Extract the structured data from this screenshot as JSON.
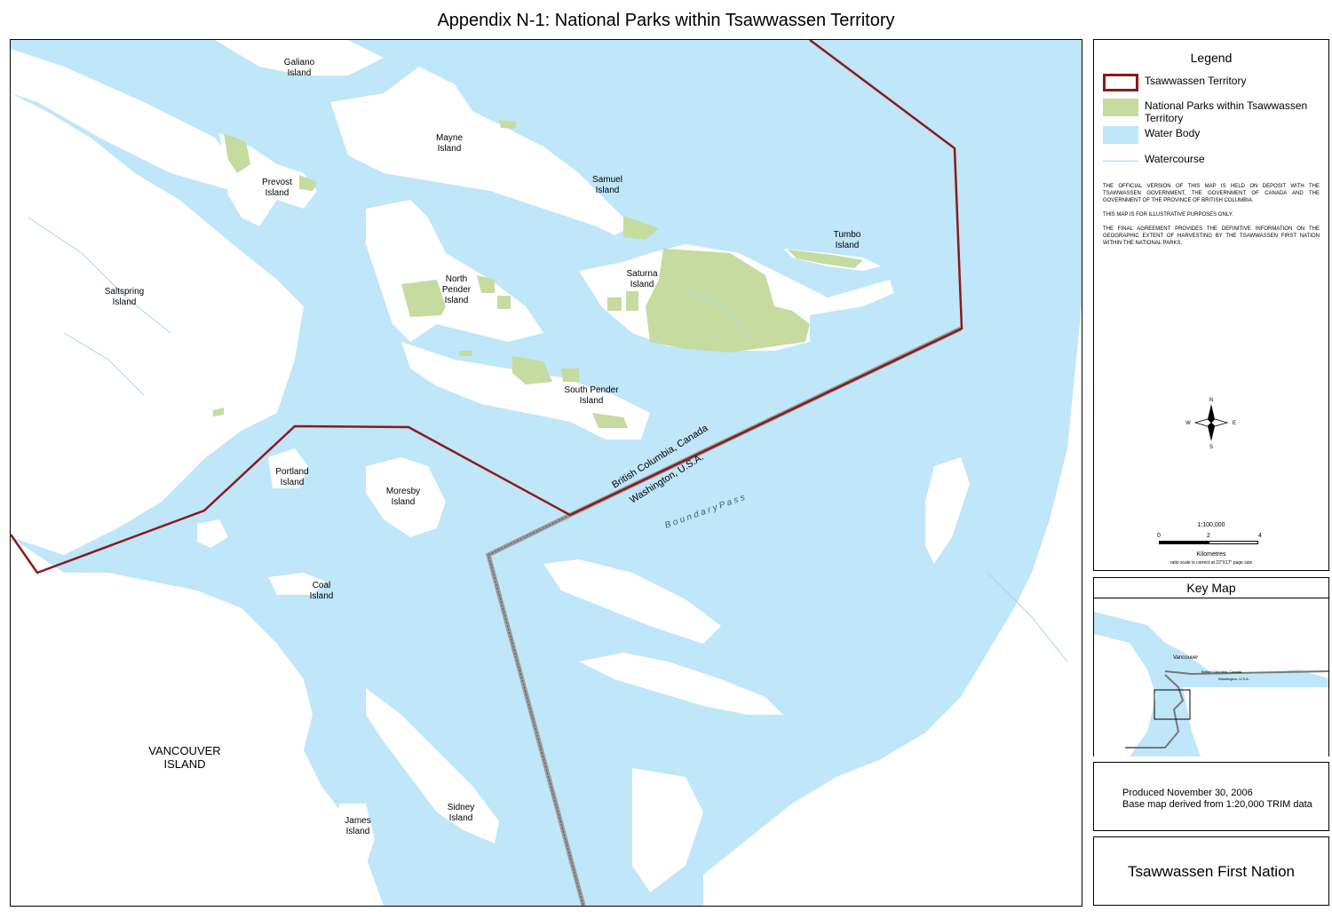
{
  "title": "Appendix N-1: National Parks within Tsawwassen Territory",
  "map": {
    "place_labels": [
      {
        "id": "galiano",
        "line1": "Galiano",
        "line2": "Island"
      },
      {
        "id": "mayne",
        "line1": "Mayne",
        "line2": "Island"
      },
      {
        "id": "prevost",
        "line1": "Prevost",
        "line2": "Island"
      },
      {
        "id": "samuel",
        "line1": "Samuel",
        "line2": "Island"
      },
      {
        "id": "tumbo",
        "line1": "Tumbo",
        "line2": "Island"
      },
      {
        "id": "saltspring",
        "line1": "Saltspring",
        "line2": "Island"
      },
      {
        "id": "north-pender",
        "line1": "North",
        "line2": "Pender",
        "line3": "Island"
      },
      {
        "id": "saturna",
        "line1": "Saturna",
        "line2": "Island"
      },
      {
        "id": "south-pender",
        "line1": "South Pender",
        "line2": "Island"
      },
      {
        "id": "portland",
        "line1": "Portland",
        "line2": "Island"
      },
      {
        "id": "moresby",
        "line1": "Moresby",
        "line2": "Island"
      },
      {
        "id": "coal",
        "line1": "Coal",
        "line2": "Island"
      },
      {
        "id": "vancouver-island",
        "line1": "VANCOUVER",
        "line2": "ISLAND"
      },
      {
        "id": "james",
        "line1": "James",
        "line2": "Island"
      },
      {
        "id": "sidney",
        "line1": "Sidney",
        "line2": "Island"
      }
    ],
    "boundary_label_north": "British Columbia, Canada",
    "boundary_label_south": "Washington, U.S.A.",
    "water_label": "B o u n d a r y   P a s s"
  },
  "legend": {
    "title": "Legend",
    "items": [
      {
        "label": "Tsawwassen Territory",
        "swatch": "outline",
        "color": "#8b1a1a"
      },
      {
        "label": "National Parks within Tsawwassen Territory",
        "swatch": "fill",
        "color": "#c5dba0"
      },
      {
        "label": "Water Body",
        "swatch": "fill",
        "color": "#bfe6f9"
      },
      {
        "label": "Watercourse",
        "swatch": "line",
        "color": "#a6d8f0"
      }
    ],
    "notes": [
      "The official version of this map is held on deposit with the Tsawwassen Government, the Government of Canada and the Government of the Province of British Columbia.",
      "This map is for illustrative purposes only.",
      "The Final Agreement provides the definitive information on the geographic extent of harvesting by the Tsawwassen First Nation within the National Parks."
    ],
    "compass": {
      "n": "N",
      "s": "S",
      "e": "E",
      "w": "W"
    },
    "scale": {
      "ratio": "1:100,000",
      "ticks": [
        "0",
        "2",
        "4"
      ],
      "unit": "Kilometres",
      "note": "ratio scale is correct at 22\"X17\" page size"
    }
  },
  "key_map": {
    "title": "Key Map",
    "city_label": "Vancouver",
    "border_north": "British Columbia, Canada",
    "border_south": "Washington, U.S.A."
  },
  "info": {
    "produced": "Produced November 30, 2006",
    "base": "Base map derived from 1:20,000 TRIM data"
  },
  "organization": "Tsawwassen First Nation",
  "colors": {
    "water": "#bfe6f9",
    "land": "#ffffff",
    "park": "#c5dba0",
    "territory": "#8b1a1a",
    "intl_boundary": "#999999"
  }
}
